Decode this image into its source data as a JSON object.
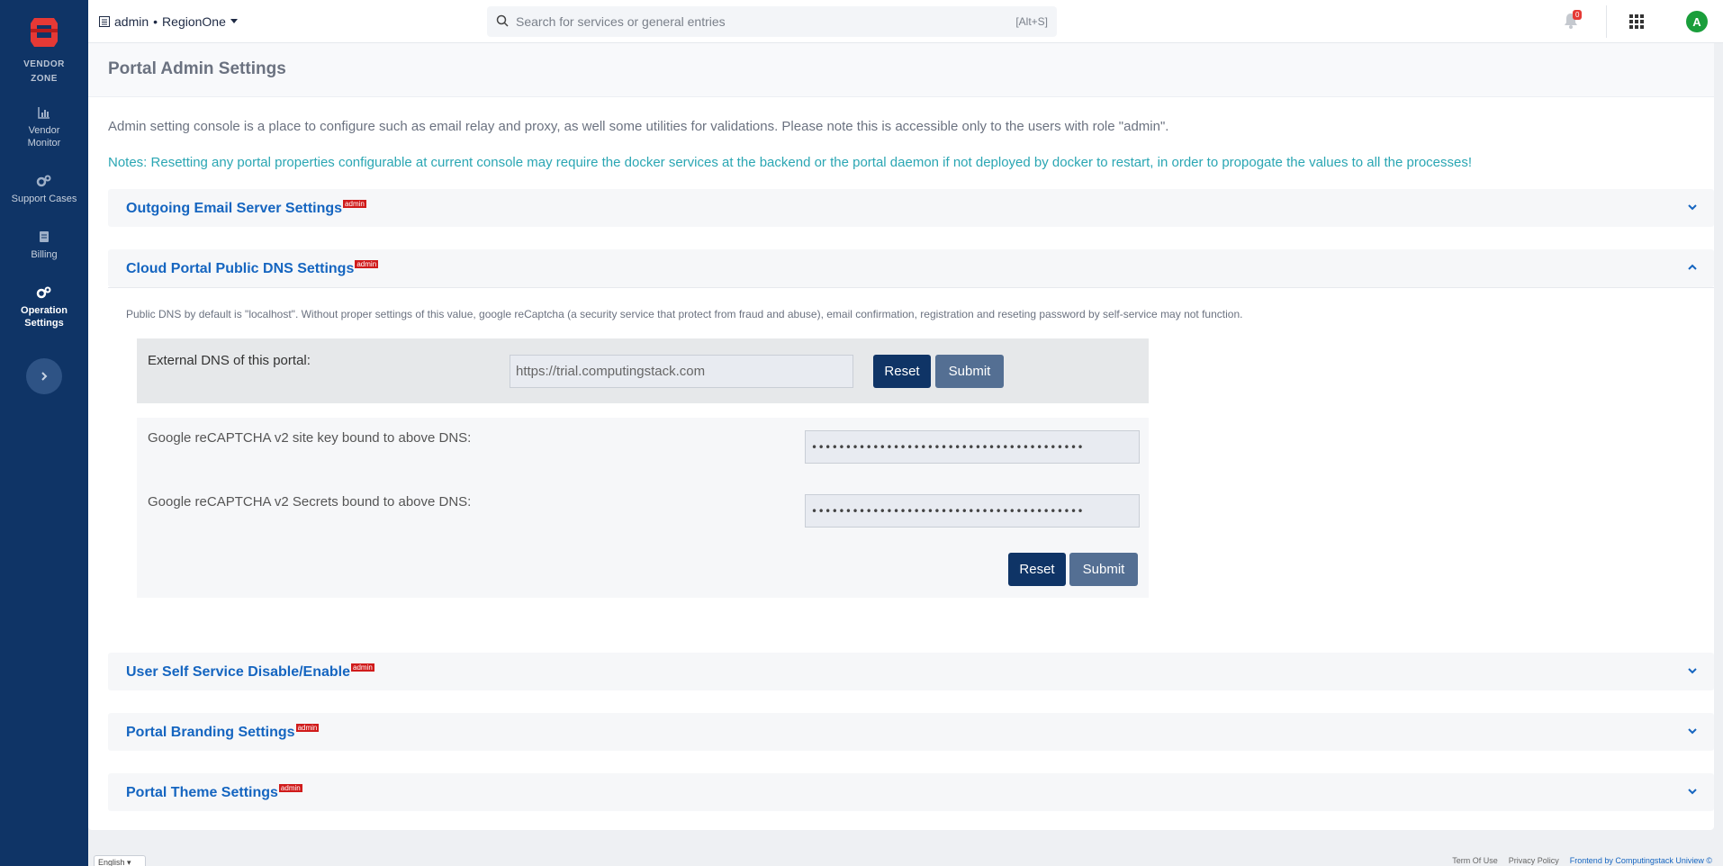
{
  "sidebar": {
    "brand_line1": "VENDOR",
    "brand_line2": "ZONE",
    "items": [
      {
        "label_line1": "Vendor",
        "label_line2": "Monitor",
        "icon": "bar-chart-icon"
      },
      {
        "label_line1": "Support Cases",
        "label_line2": "",
        "icon": "gears-icon"
      },
      {
        "label_line1": "Billing",
        "label_line2": "",
        "icon": "document-icon"
      },
      {
        "label_line1": "Operation",
        "label_line2": "Settings",
        "icon": "gears-icon",
        "active": true
      }
    ]
  },
  "topbar": {
    "user": "admin",
    "separator": "•",
    "region": "RegionOne",
    "search_placeholder": "Search for services or general entries",
    "search_hint": "[Alt+S]",
    "notification_count": "0",
    "avatar_initial": "A"
  },
  "page": {
    "title": "Portal Admin Settings",
    "description": "Admin setting console is a place to configure such as email relay and proxy, as well some utilities for validations. Please note this is accessible only to the users with role \"admin\".",
    "note": "Notes: Resetting any portal properties configurable at current console may require the docker services at the backend or the portal daemon if not deployed by docker to restart, in order to propogate the values to all the processes!"
  },
  "sections": {
    "tag": "admin",
    "email": "Outgoing Email Server Settings",
    "dns": "Cloud Portal Public DNS Settings",
    "self_service": "User Self Service Disable/Enable",
    "branding": "Portal Branding Settings",
    "theme": "Portal Theme Settings"
  },
  "dns": {
    "info": "Public DNS by default is \"localhost\". Without proper settings of this value, google reCaptcha (a security service that protect from fraud and abuse), email confirmation, registration and reseting password by self-service may not function.",
    "external_label": "External DNS of this portal:",
    "external_value": "https://trial.computingstack.com",
    "site_key_label": "Google reCAPTCHA v2 site key bound to above DNS:",
    "site_key_value": "••••••••••••••••••••••••••••••••••••••••",
    "secret_label": "Google reCAPTCHA v2 Secrets bound to above DNS:",
    "secret_value": "••••••••••••••••••••••••••••••••••••••••",
    "reset_label": "Reset",
    "submit_label": "Submit"
  },
  "footer": {
    "language": "English",
    "terms": "Term Of Use",
    "privacy": "Privacy Policy",
    "credit": "Frontend by Computingstack Uniview ©"
  },
  "colors": {
    "sidebar": "#0f3466",
    "link": "#1565c0",
    "note": "#2aa6b3",
    "tag": "#d01b1b"
  }
}
